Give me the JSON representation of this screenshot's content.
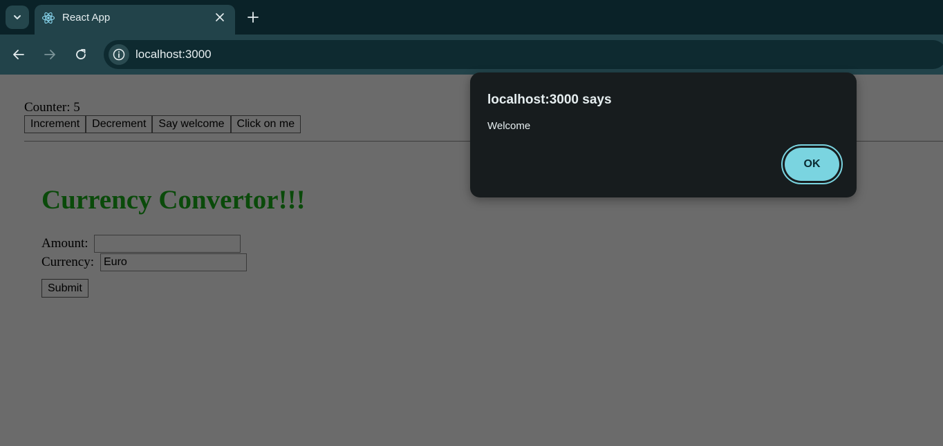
{
  "browser": {
    "tab": {
      "title": "React App",
      "favicon": "react-atom-icon"
    },
    "address_bar": {
      "url": "localhost:3000"
    },
    "colors": {
      "chrome_dark": "#0a2228",
      "chrome": "#22434a",
      "accent": "#7ad4e0"
    }
  },
  "page": {
    "counter_label": "Counter: 5",
    "buttons": {
      "increment": "Increment",
      "decrement": "Decrement",
      "say_welcome": "Say welcome",
      "click_on_me": "Click on me"
    },
    "heading": "Currency Convertor!!!",
    "form": {
      "amount_label": "Amount:",
      "amount_value": "",
      "currency_label": "Currency:",
      "currency_value": "Euro",
      "submit_label": "Submit"
    }
  },
  "dialog": {
    "title": "localhost:3000 says",
    "message": "Welcome",
    "ok_label": "OK"
  }
}
